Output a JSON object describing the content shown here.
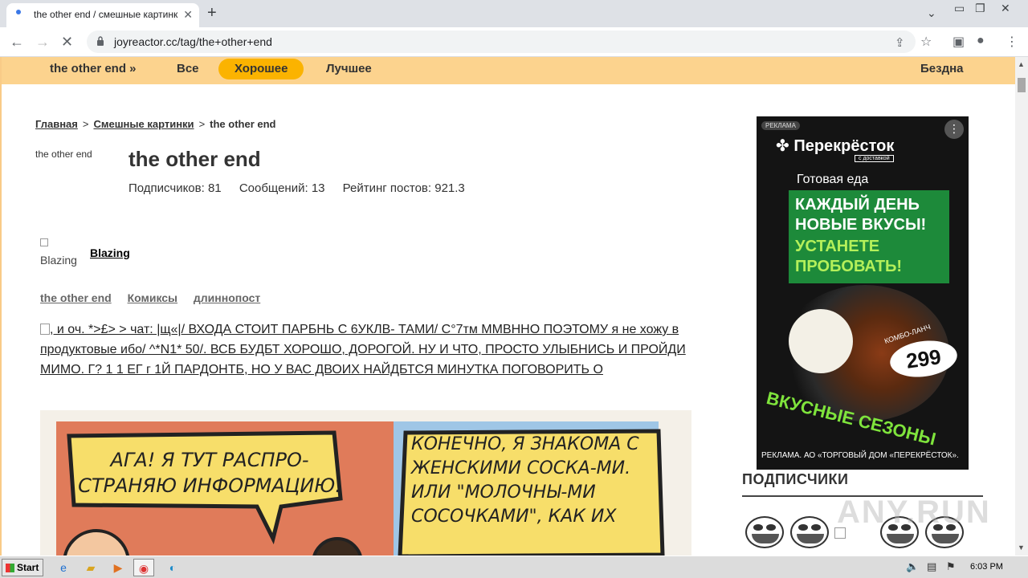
{
  "browser": {
    "tab_title": "the other end / смешные картинки",
    "url": "joyreactor.cc/tag/the+other+end"
  },
  "topnav": {
    "item1": "the other end »",
    "item2": "Все",
    "item3": "Хорошее",
    "item4": "Лучшее",
    "item5": "Бездна"
  },
  "breadcrumb": {
    "home": "Главная",
    "sep": ">",
    "section": "Смешные картинки",
    "current": "the other end"
  },
  "tag": {
    "image_alt": "the other end",
    "title": "the other end",
    "subscribers": "Подписчиков: 81",
    "posts": "Сообщений: 13",
    "rating": "Рейтинг постов: 921.3"
  },
  "post": {
    "avatar_alt": "Blazing",
    "username": "Blazing",
    "tags": [
      "the other end",
      "Комиксы",
      "длиннопост"
    ],
    "text": ", и оч. *>£> > чат: |щ«|/ ВХОДА СТОИТ ПАРБНЬ С 6УКЛВ- ТАМИ/ С°7тм ММВННО ПОЭТОМУ я не хожу в продуктовые ибо/ ^*N1* 50/. ВСБ БУДБТ ХОРОШО, ДОРОГОЙ. НУ И ЧТО, ПРОСТО УЛЫБНИСЬ И ПРОЙДИ МИМО. Г? 1 1 ЕГ г 1Й ПАРДОНТБ, НО У ВАС ДВОИХ НАЙДБТСЯ МИНУТКА ПОГОВОРИТЬ О",
    "comic_bubble1": "АГА! Я ТУТ РАСПРО-СТРАНЯЮ ИНФОРМАЦИЮ.",
    "comic_bubble2": "КОНЕЧНО, Я ЗНАКОМА С ЖЕНСКИМИ СОСКА-МИ. ИЛИ \"МОЛОЧНЫ-МИ СОСОЧКАМИ\", КАК ИХ"
  },
  "ad": {
    "label": "РЕКЛАМА",
    "brand": "Перекрёсток",
    "brand_sub": "с доставкой",
    "ready_food": "Готовая еда",
    "headline": "КАЖДЫЙ ДЕНЬ НОВЫЕ ВКУСЫ!",
    "headline2": "УСТАНЕТЕ ПРОБОВАТЬ!",
    "combo": "КОМБО-ЛАНЧ",
    "price": "299",
    "seasons": "ВКУСНЫЕ СЕЗОНЫ",
    "footer": "РЕКЛАМА. АО «ТОРГОВЫЙ ДОМ «ПЕРЕКРЁСТОК»."
  },
  "sidebar": {
    "subscribers_title": "ПОДПИСЧИКИ",
    "watermark": "ANY.RUN"
  },
  "taskbar": {
    "start": "Start",
    "clock": "6:03 PM"
  },
  "colors": {
    "nav_bg": "#fcd38e",
    "nav_active": "#fbb300",
    "ad_green": "#1d8a3a",
    "ad_lime": "#7fe43c"
  }
}
